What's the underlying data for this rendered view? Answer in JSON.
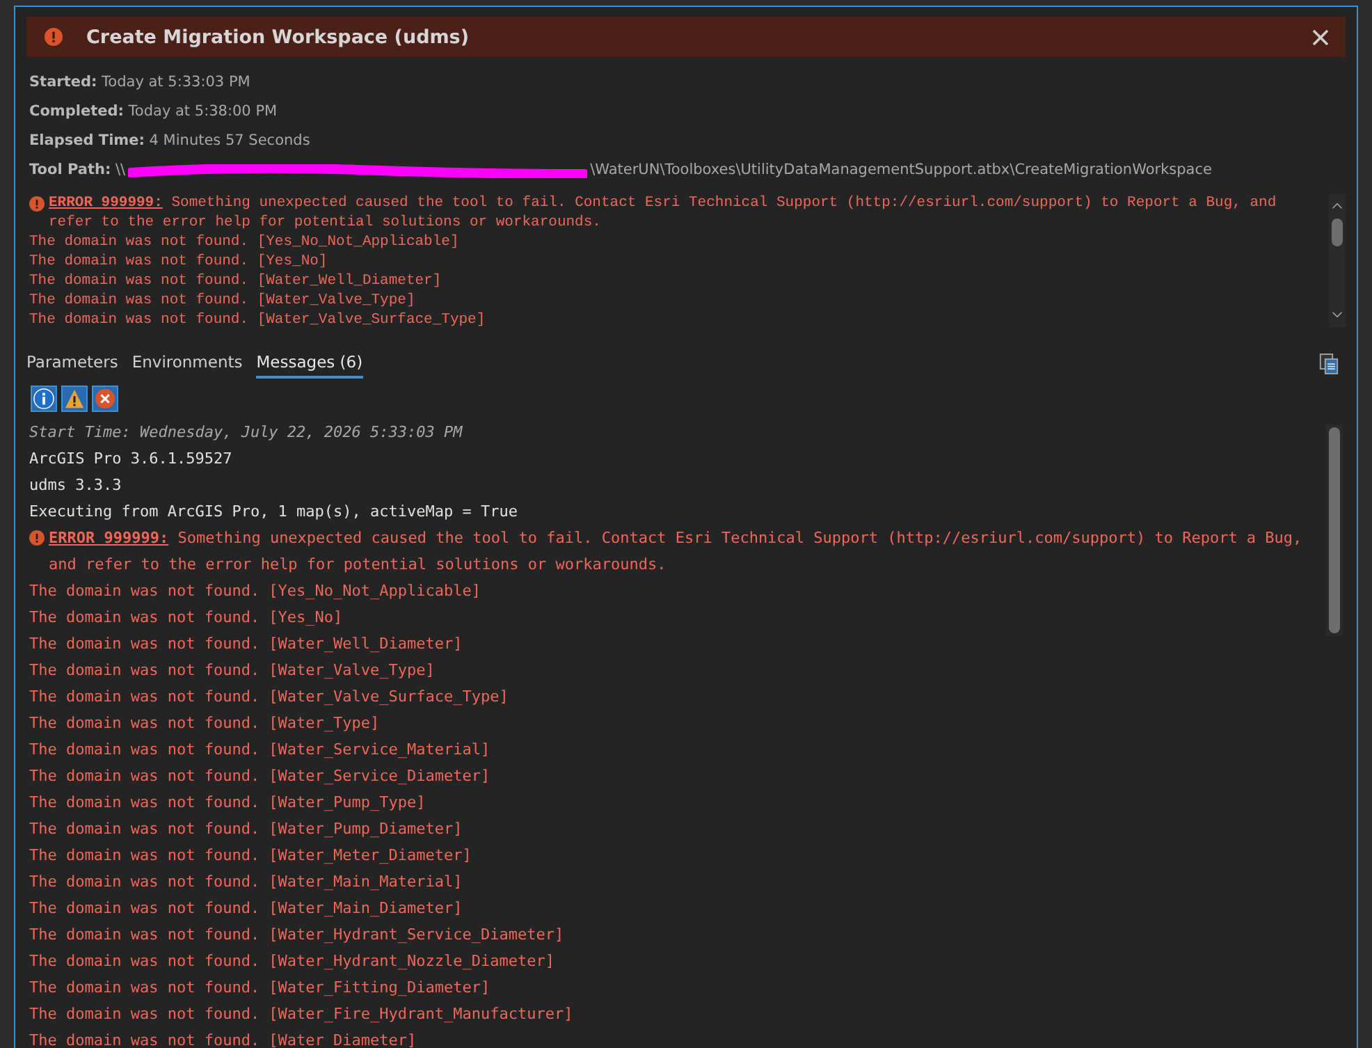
{
  "dialog": {
    "title": "Create Migration Workspace (udms)",
    "info": [
      {
        "label": "Started:",
        "value": "Today at 5:33:03 PM"
      },
      {
        "label": "Completed:",
        "value": "Today at 5:38:00 PM"
      },
      {
        "label": "Elapsed Time:",
        "value": "4 Minutes 57 Seconds"
      }
    ],
    "tool_path": {
      "label": "Tool Path:",
      "prefix": "\\\\",
      "suffix": "\\WaterUN\\Toolboxes\\UtilityDataManagementSupport.atbx\\CreateMigrationWorkspace"
    },
    "summary": [
      {
        "kind": "error",
        "code": "ERROR 999999:",
        "text": "Something unexpected caused the tool to fail. Contact Esri Technical Support (http://esriurl.com/support) to Report a Bug, and refer to the error help for potential solutions or workarounds."
      },
      {
        "kind": "domain",
        "text": "The domain was not found. [Yes_No_Not_Applicable]"
      },
      {
        "kind": "domain",
        "text": "The domain was not found. [Yes_No]"
      },
      {
        "kind": "domain",
        "text": "The domain was not found. [Water_Well_Diameter]"
      },
      {
        "kind": "domain",
        "text": "The domain was not found. [Water_Valve_Type]"
      },
      {
        "kind": "domain",
        "text": "The domain was not found. [Water_Valve_Surface_Type]"
      }
    ],
    "tabs": [
      {
        "label": "Parameters",
        "selected": false
      },
      {
        "label": "Environments",
        "selected": false
      },
      {
        "label": "Messages (6)",
        "selected": true
      }
    ],
    "filters": [
      {
        "kind": "info",
        "selected": true
      },
      {
        "kind": "warning",
        "selected": true
      },
      {
        "kind": "error",
        "selected": true
      }
    ],
    "messages": [
      {
        "kind": "start",
        "text": "Start Time: Wednesday, July 22, 2026 5:33:03 PM"
      },
      {
        "kind": "plain",
        "text": "ArcGIS Pro 3.6.1.59527"
      },
      {
        "kind": "plain",
        "text": "udms 3.3.3"
      },
      {
        "kind": "plain",
        "text": "Executing from ArcGIS Pro, 1 map(s), activeMap = True"
      },
      {
        "kind": "error",
        "code": "ERROR 999999:",
        "text": "Something unexpected caused the tool to fail. Contact Esri Technical Support (http://esriurl.com/support) to Report a Bug, and refer to the error help for potential solutions or workarounds."
      },
      {
        "kind": "domain",
        "text": "The domain was not found. [Yes_No_Not_Applicable]"
      },
      {
        "kind": "domain",
        "text": "The domain was not found. [Yes_No]"
      },
      {
        "kind": "domain",
        "text": "The domain was not found. [Water_Well_Diameter]"
      },
      {
        "kind": "domain",
        "text": "The domain was not found. [Water_Valve_Type]"
      },
      {
        "kind": "domain",
        "text": "The domain was not found. [Water_Valve_Surface_Type]"
      },
      {
        "kind": "domain",
        "text": "The domain was not found. [Water_Type]"
      },
      {
        "kind": "domain",
        "text": "The domain was not found. [Water_Service_Material]"
      },
      {
        "kind": "domain",
        "text": "The domain was not found. [Water_Service_Diameter]"
      },
      {
        "kind": "domain",
        "text": "The domain was not found. [Water_Pump_Type]"
      },
      {
        "kind": "domain",
        "text": "The domain was not found. [Water_Pump_Diameter]"
      },
      {
        "kind": "domain",
        "text": "The domain was not found. [Water_Meter_Diameter]"
      },
      {
        "kind": "domain",
        "text": "The domain was not found. [Water_Main_Material]"
      },
      {
        "kind": "domain",
        "text": "The domain was not found. [Water_Main_Diameter]"
      },
      {
        "kind": "domain",
        "text": "The domain was not found. [Water_Hydrant_Service_Diameter]"
      },
      {
        "kind": "domain",
        "text": "The domain was not found. [Water_Hydrant_Nozzle_Diameter]"
      },
      {
        "kind": "domain",
        "text": "The domain was not found. [Water_Fitting_Diameter]"
      },
      {
        "kind": "domain",
        "text": "The domain was not found. [Water_Fire_Hydrant_Manufacturer]"
      },
      {
        "kind": "domain",
        "text": "The domain was not found. [Water_Diameter]"
      }
    ]
  }
}
